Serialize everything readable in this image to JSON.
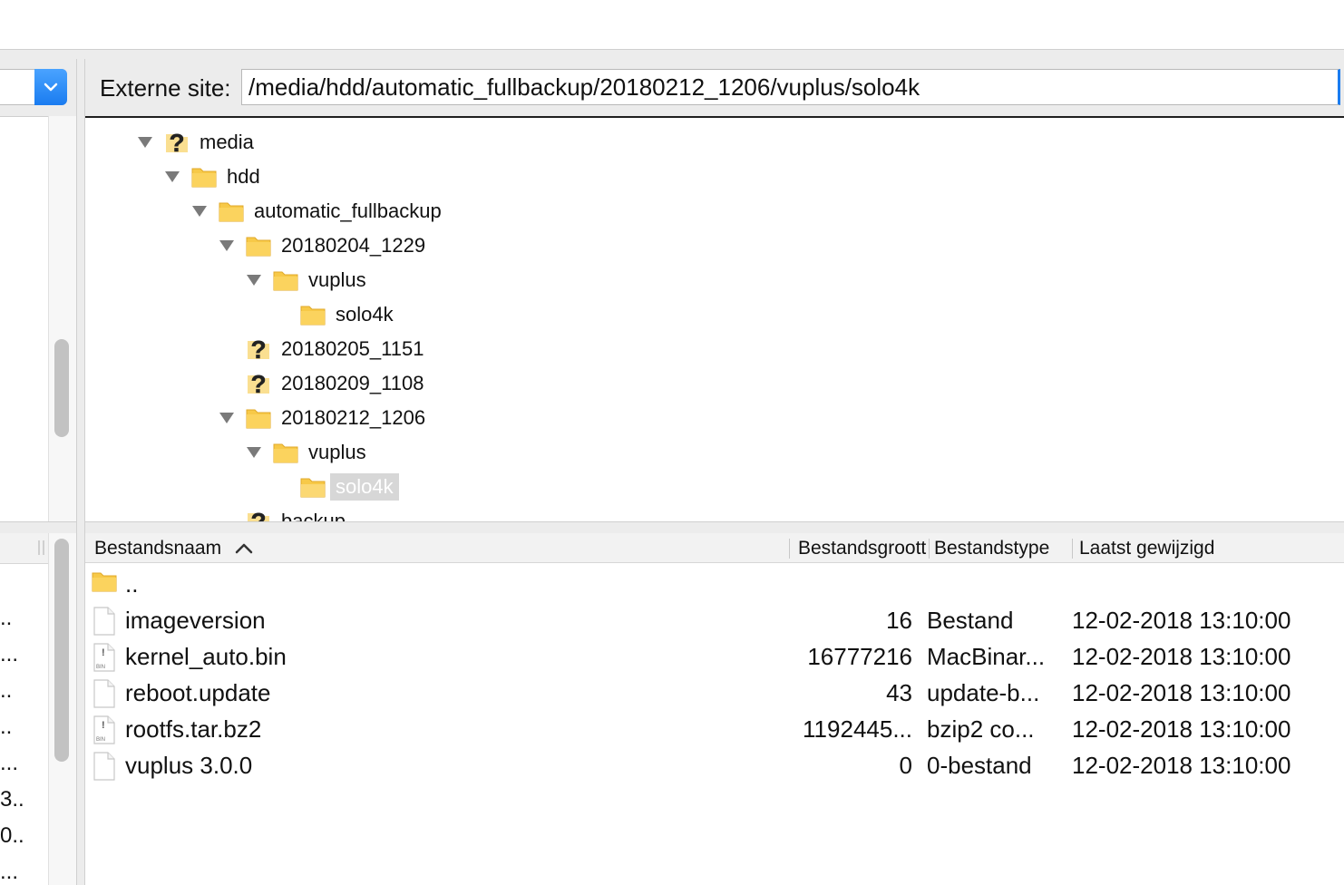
{
  "remote_site": {
    "label": "Externe site:",
    "path": "/media/hdd/automatic_fullbackup/20180212_1206/vuplus/solo4k"
  },
  "icons": {
    "dropdown": "chevron-down-icon",
    "expanded": "disclosure-triangle-down-icon",
    "unknown_folder": "question-folder-icon",
    "folder": "folder-icon",
    "file": "file-icon",
    "binary_file": "binary-file-icon",
    "sort": "sort-ascending-icon"
  },
  "colors": {
    "accent": "#1a7cf0",
    "folder": "#f7c948",
    "question": "#e8a317",
    "selection": "#d7d7d7"
  },
  "tree": [
    {
      "label": "media",
      "icon": "question",
      "expanded": true,
      "depth": 0
    },
    {
      "label": "hdd",
      "icon": "folder",
      "expanded": true,
      "depth": 1
    },
    {
      "label": "automatic_fullbackup",
      "icon": "folder",
      "expanded": true,
      "depth": 2
    },
    {
      "label": "20180204_1229",
      "icon": "folder",
      "expanded": true,
      "depth": 3
    },
    {
      "label": "vuplus",
      "icon": "folder",
      "expanded": true,
      "depth": 4
    },
    {
      "label": "solo4k",
      "icon": "folder",
      "expanded": false,
      "depth": 5
    },
    {
      "label": "20180205_1151",
      "icon": "question",
      "expanded": false,
      "depth": 3
    },
    {
      "label": "20180209_1108",
      "icon": "question",
      "expanded": false,
      "depth": 3
    },
    {
      "label": "20180212_1206",
      "icon": "folder",
      "expanded": true,
      "depth": 3
    },
    {
      "label": "vuplus",
      "icon": "folder",
      "expanded": true,
      "depth": 4
    },
    {
      "label": "solo4k",
      "icon": "folder-open",
      "expanded": false,
      "depth": 5,
      "selected": true
    },
    {
      "label": "backup",
      "icon": "question",
      "expanded": false,
      "depth": 3
    }
  ],
  "file_list": {
    "columns": {
      "name": "Bestandsnaam",
      "size": "Bestandsgrootte",
      "type": "Bestandstype",
      "modified": "Laatst gewijzigd"
    },
    "rows": [
      {
        "name": "..",
        "size": "",
        "type": "",
        "modified": "",
        "icon": "folder"
      },
      {
        "name": "imageversion",
        "size": "16",
        "type": "Bestand",
        "modified": "12-02-2018 13:10:00",
        "icon": "file"
      },
      {
        "name": "kernel_auto.bin",
        "size": "16777216",
        "type": "MacBinar...",
        "modified": "12-02-2018 13:10:00",
        "icon": "binary"
      },
      {
        "name": "reboot.update",
        "size": "43",
        "type": "update-b...",
        "modified": "12-02-2018 13:10:00",
        "icon": "file"
      },
      {
        "name": "rootfs.tar.bz2",
        "size": "1192445...",
        "type": "bzip2 co...",
        "modified": "12-02-2018 13:10:00",
        "icon": "binary"
      },
      {
        "name": "vuplus 3.0.0",
        "size": "0",
        "type": "0-bestand",
        "modified": "12-02-2018 13:10:00",
        "icon": "file"
      }
    ]
  },
  "left_list_truncated": [
    "..",
    "...",
    "..",
    "..",
    "...",
    "3...",
    "0...",
    "..."
  ]
}
